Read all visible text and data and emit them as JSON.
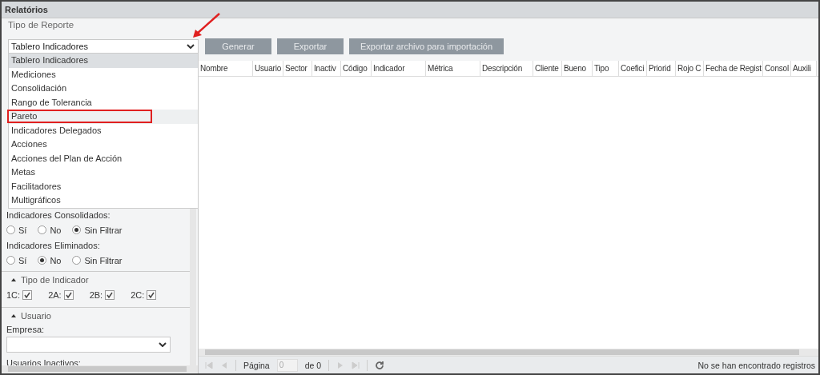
{
  "window": {
    "title": "Relatórios"
  },
  "report_type": {
    "legend": "Tipo de Reporte",
    "value": "Tablero Indicadores",
    "open": true,
    "arrow_annotation": true,
    "options": [
      {
        "label": "Tablero Indicadores",
        "selected": true,
        "hovered": false,
        "highlighted": false
      },
      {
        "label": "Mediciones",
        "selected": false,
        "hovered": false,
        "highlighted": false
      },
      {
        "label": "Consolidación",
        "selected": false,
        "hovered": false,
        "highlighted": false
      },
      {
        "label": "Rango de Tolerancia",
        "selected": false,
        "hovered": false,
        "highlighted": false
      },
      {
        "label": "Pareto",
        "selected": false,
        "hovered": true,
        "highlighted": true
      },
      {
        "label": "Indicadores Delegados",
        "selected": false,
        "hovered": false,
        "highlighted": false
      },
      {
        "label": "Acciones",
        "selected": false,
        "hovered": false,
        "highlighted": false
      },
      {
        "label": "Acciones del Plan de Acción",
        "selected": false,
        "hovered": false,
        "highlighted": false
      },
      {
        "label": "Metas",
        "selected": false,
        "hovered": false,
        "highlighted": false
      },
      {
        "label": "Facilitadores",
        "selected": false,
        "hovered": false,
        "highlighted": false
      },
      {
        "label": "Multigráficos",
        "selected": false,
        "hovered": false,
        "highlighted": false
      }
    ]
  },
  "buttons": [
    {
      "label": "Generar",
      "disabled": true
    },
    {
      "label": "Exportar",
      "disabled": true
    },
    {
      "label": "Exportar archivo para importación",
      "disabled": true
    }
  ],
  "filters": [
    {
      "label": "Indicadores Consolidados:",
      "options": [
        {
          "label": "Sí",
          "selected": false
        },
        {
          "label": "No",
          "selected": false
        },
        {
          "label": "Sin Filtrar",
          "selected": true
        }
      ]
    },
    {
      "label": "Indicadores Eliminados:",
      "options": [
        {
          "label": "Sí",
          "selected": false
        },
        {
          "label": "No",
          "selected": true
        },
        {
          "label": "Sin Filtrar",
          "selected": false
        }
      ]
    }
  ],
  "indicator_type": {
    "legend": "Tipo de Indicador",
    "expanded": true,
    "items": [
      {
        "label": "1C:",
        "checked": true
      },
      {
        "label": "2A:",
        "checked": true
      },
      {
        "label": "2B:",
        "checked": true
      },
      {
        "label": "2C:",
        "checked": true
      }
    ]
  },
  "user": {
    "legend": "Usuario",
    "expanded": true,
    "company_label": "Empresa:",
    "inactive_label": "Usuarios Inactivos:"
  },
  "table": {
    "columns": [
      "Nombre",
      "Usuario",
      "Sector",
      "Inactiv",
      "Código",
      "Indicador",
      "Métrica",
      "Descripción",
      "Cliente",
      "Bueno",
      "Tipo",
      "Coefici",
      "Priorid",
      "Rojo C",
      "Fecha de Regist",
      "Consol",
      "Auxili"
    ]
  },
  "pager": {
    "page_label": "Página",
    "page_value": "0",
    "of_label": "de 0",
    "status": "No se han encontrado registros"
  }
}
